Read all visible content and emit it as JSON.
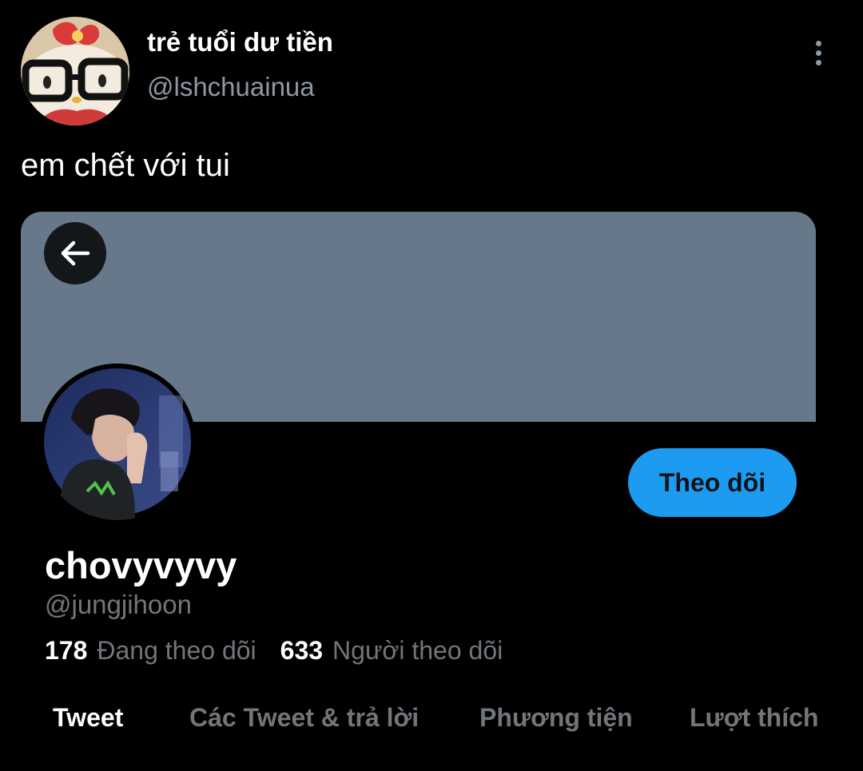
{
  "tweet": {
    "author_name": "trẻ tuổi dư tiền",
    "author_handle": "@lshchuainua",
    "avatar_icon": "hello-kitty-glasses-avatar",
    "more_icon": "more-vertical-icon",
    "text": "em chết với tui"
  },
  "profile": {
    "back_icon": "arrow-left-icon",
    "banner_color": "#66788a",
    "avatar_icon": "profile-photo",
    "follow_label": "Theo dõi",
    "name": "chovyvyvy",
    "handle": "@jungjihoon",
    "following_count": "178",
    "following_label": "Đang theo dõi",
    "followers_count": "633",
    "followers_label": "Người theo dõi",
    "tabs": [
      {
        "label": "Tweet",
        "active": true
      },
      {
        "label": "Các Tweet & trả lời",
        "active": false
      },
      {
        "label": "Phương tiện",
        "active": false
      },
      {
        "label": "Lượt thích",
        "active": false
      }
    ]
  },
  "colors": {
    "background": "#000000",
    "accent": "#1d9bf0",
    "secondary_text": "#71767b"
  }
}
